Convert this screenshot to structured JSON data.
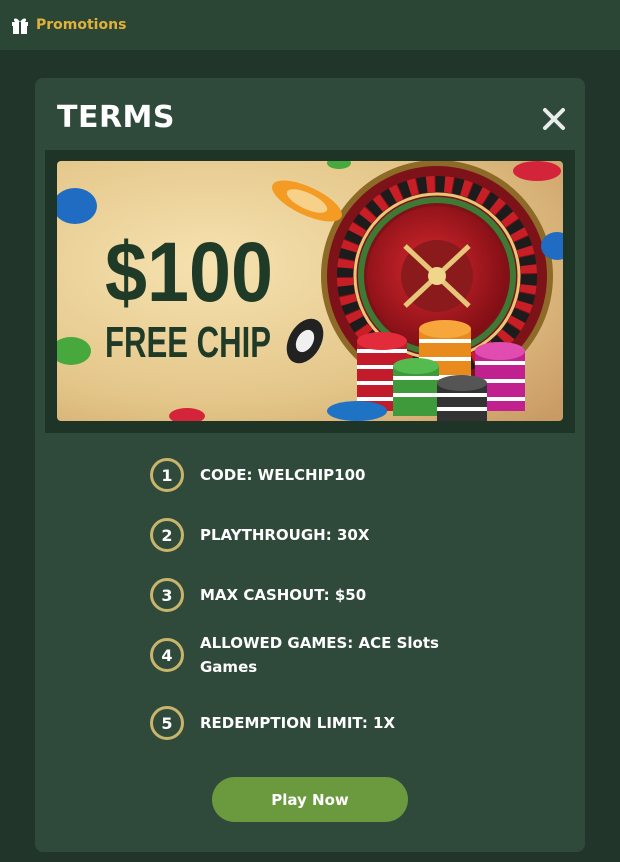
{
  "header": {
    "icon": "gift-icon",
    "label": "Promotions",
    "accent": "#e0b23a"
  },
  "modal": {
    "title": "TERMS",
    "close_icon": "close-icon",
    "banner": {
      "amount": "$100",
      "subtitle": "FREE CHIP",
      "image": "roulette-and-casino-chips"
    },
    "terms": [
      {
        "num": "1",
        "text": "CODE: WELCHIP100"
      },
      {
        "num": "2",
        "text": "PLAYTHROUGH: 30X"
      },
      {
        "num": "3",
        "text": "MAX CASHOUT: $50"
      },
      {
        "num": "4",
        "text": "ALLOWED GAMES: ACE Slots Games"
      },
      {
        "num": "5",
        "text": "REDEMPTION LIMIT: 1X"
      }
    ],
    "cta_label": "Play Now",
    "colors": {
      "background": "#22352a",
      "panel": "#2f4a3b",
      "badge_ring": "#c9b46b",
      "button": "#6b9a3e"
    }
  }
}
